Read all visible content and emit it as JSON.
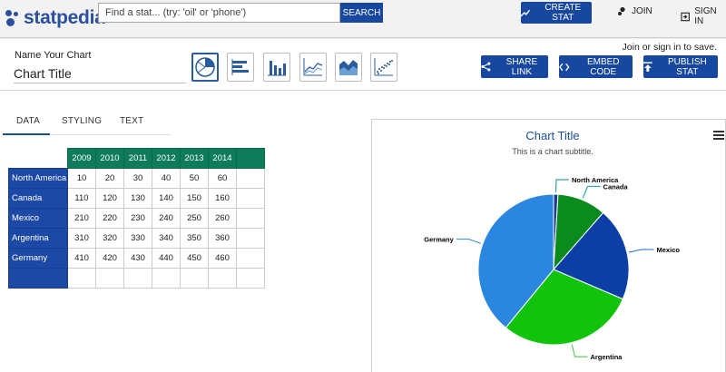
{
  "header": {
    "logo_text": "statpedia",
    "search_placeholder": "Find a stat... (try: 'oil' or 'phone')",
    "search_button": "SEARCH",
    "create_button": "CREATE STAT",
    "join_label": "JOIN",
    "signin_label": "SIGN IN"
  },
  "editor": {
    "name_label": "Name Your Chart",
    "name_value": "Chart Title",
    "save_note": "Join or sign in to save.",
    "chart_types": [
      "pie",
      "horizontal-bar",
      "vertical-bar",
      "line",
      "area",
      "scatter"
    ],
    "active_chart_type": "pie",
    "share_button": "SHARE LINK",
    "embed_button": "EMBED CODE",
    "publish_button": "PUBLISH STAT"
  },
  "tabs": [
    {
      "label": "DATA",
      "active": true
    },
    {
      "label": "STYLING",
      "active": false
    },
    {
      "label": "TEXT",
      "active": false
    }
  ],
  "table": {
    "years": [
      "2009",
      "2010",
      "2011",
      "2012",
      "2013",
      "2014"
    ],
    "rows": [
      {
        "label": "North America",
        "values": [
          "10",
          "20",
          "30",
          "40",
          "50",
          "60"
        ]
      },
      {
        "label": "Canada",
        "values": [
          "110",
          "120",
          "130",
          "140",
          "150",
          "160"
        ]
      },
      {
        "label": "Mexico",
        "values": [
          "210",
          "220",
          "230",
          "240",
          "250",
          "260"
        ]
      },
      {
        "label": "Argentina",
        "values": [
          "310",
          "320",
          "330",
          "340",
          "350",
          "360"
        ]
      },
      {
        "label": "Germany",
        "values": [
          "410",
          "420",
          "430",
          "440",
          "450",
          "460"
        ]
      }
    ]
  },
  "chart_data": {
    "type": "pie",
    "title": "Chart Title",
    "subtitle": "This is a chart subtitle.",
    "categories": [
      "North America",
      "Canada",
      "Mexico",
      "Argentina",
      "Germany"
    ],
    "values": [
      10,
      110,
      210,
      310,
      410
    ],
    "colors": [
      "#1a3d8f",
      "#0b8a1e",
      "#0b3fa6",
      "#12c30c",
      "#2a86de"
    ],
    "label_color": "#000000",
    "leader_colors": [
      "#0a8a8a",
      "#0aa0a0",
      "#1b6dd1",
      "#3fc13b",
      "#2a86de"
    ]
  },
  "colors": {
    "brand_blue": "#17479e",
    "header_green": "#0e7c5a",
    "row_blue": "#1d49a6",
    "title_blue": "#1b4e92"
  }
}
